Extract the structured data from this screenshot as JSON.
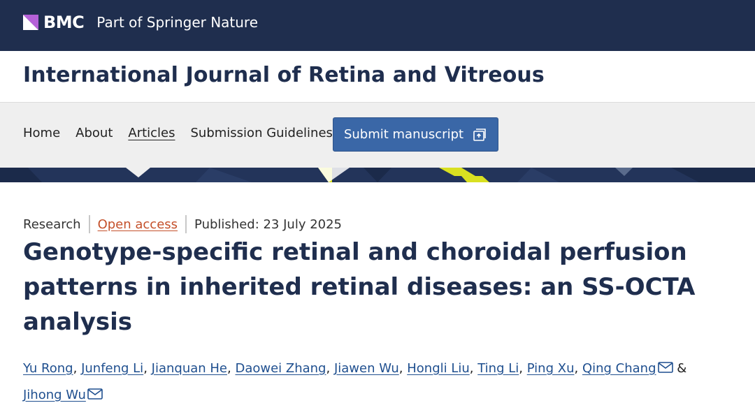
{
  "header": {
    "brand": "BMC",
    "brand_sub": "Part of Springer Nature"
  },
  "journal": {
    "title": "International Journal of Retina and Vitreous"
  },
  "nav": {
    "items": [
      {
        "label": "Home",
        "active": false
      },
      {
        "label": "About",
        "active": false
      },
      {
        "label": "Articles",
        "active": true
      },
      {
        "label": "Submission Guidelines",
        "active": false
      }
    ],
    "submit_label": "Submit manuscript",
    "submit_icon": "external-link-icon"
  },
  "article": {
    "type": "Research",
    "access": "Open access",
    "published": "Published: 23 July 2025",
    "title": "Genotype-specific retinal and choroidal perfusion patterns in inherited retinal diseases: an SS-OCTA analysis",
    "authors": [
      {
        "name": "Yu Rong",
        "mail": false
      },
      {
        "name": "Junfeng Li",
        "mail": false
      },
      {
        "name": "Jianquan He",
        "mail": false
      },
      {
        "name": "Daowei Zhang",
        "mail": false
      },
      {
        "name": "Jiawen Wu",
        "mail": false
      },
      {
        "name": "Hongli Liu",
        "mail": false
      },
      {
        "name": "Ting Li",
        "mail": false
      },
      {
        "name": "Ping Xu",
        "mail": false
      },
      {
        "name": "Qing Chang",
        "mail": true
      },
      {
        "name": "Jihong Wu",
        "mail": true
      }
    ],
    "author_separator": ", ",
    "author_last_separator": "&"
  },
  "colors": {
    "brand_navy": "#1f2e4e",
    "button_blue": "#3a67a7",
    "link_blue": "#1f4f8f",
    "open_access_orange": "#c4502a",
    "pattern_yellow": "#d9e021"
  }
}
